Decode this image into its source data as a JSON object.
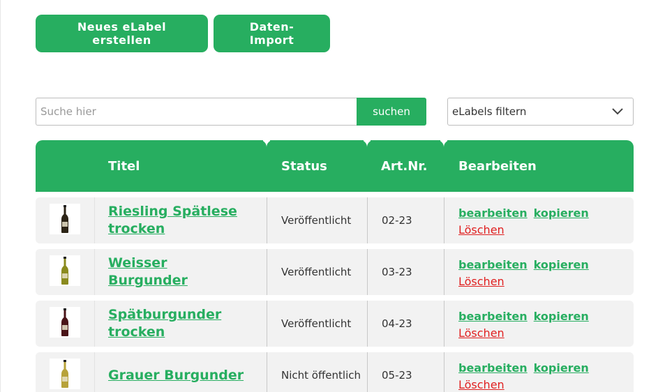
{
  "toolbar": {
    "new_label": "Neues eLabel erstellen",
    "import_label": "Daten-Import"
  },
  "search": {
    "placeholder": "Suche hier",
    "value": "",
    "button_label": "suchen"
  },
  "filter": {
    "selected": "eLabels filtern"
  },
  "table": {
    "headers": {
      "image": "",
      "title": "Titel",
      "status": "Status",
      "artnr": "Art.Nr.",
      "actions": "Bearbeiten"
    },
    "action_labels": {
      "edit": "bearbeiten",
      "copy": "kopieren",
      "delete": "Löschen"
    },
    "rows": [
      {
        "title": "Riesling Spätlese trocken",
        "status": "Veröffentlicht",
        "artnr": "02-23",
        "bottle": "bottle-dark-icon",
        "bottle_color": "#2c2416"
      },
      {
        "title": "Weisser Burgunder",
        "status": "Veröffentlicht",
        "artnr": "03-23",
        "bottle": "bottle-green-icon",
        "bottle_color": "#8a8a1e"
      },
      {
        "title": "Spätburgunder trocken",
        "status": "Veröffentlicht",
        "artnr": "04-23",
        "bottle": "bottle-red-icon",
        "bottle_color": "#4a1418"
      },
      {
        "title": "Grauer Burgunder",
        "status": "Nicht öffentlich",
        "artnr": "05-23",
        "bottle": "bottle-gold-icon",
        "bottle_color": "#b7a23a"
      }
    ]
  },
  "colors": {
    "accent": "#27ae60",
    "delete": "#e02020",
    "row_bg": "#f2f2f2"
  }
}
